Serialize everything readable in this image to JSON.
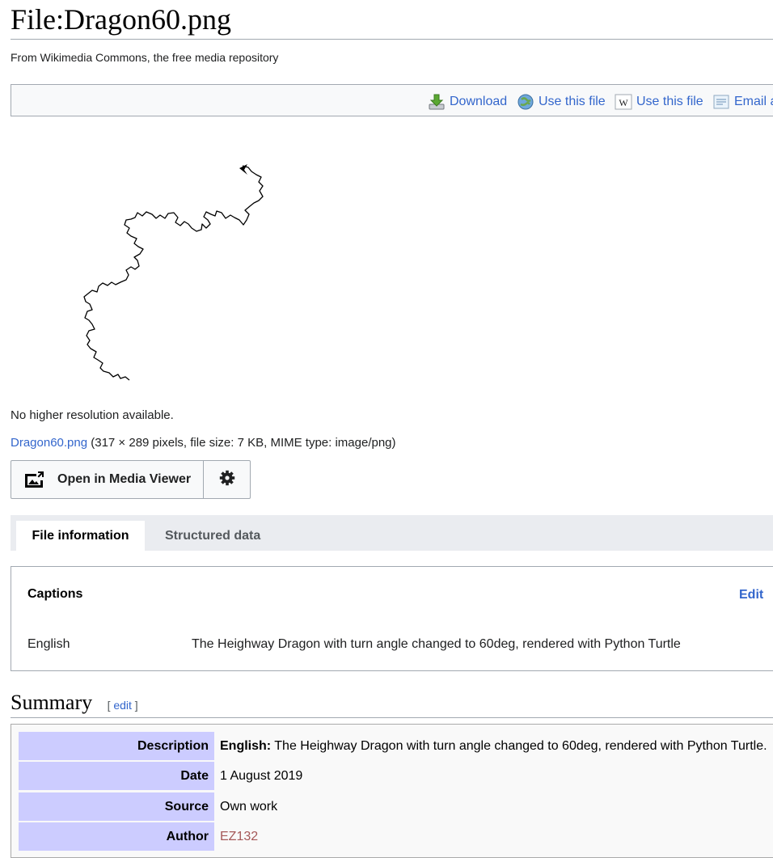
{
  "page": {
    "title": "File:Dragon60.png",
    "subtitle": "From Wikimedia Commons, the free media repository"
  },
  "toolbar": {
    "download": "Download",
    "use_web": "Use this file",
    "use_wiki": "Use this file",
    "email": "Email a"
  },
  "file": {
    "no_hires": "No higher resolution available.",
    "name_link": "Dragon60.png",
    "details": " (317 × 289 pixels, file size: 7 KB, MIME type: image/png)"
  },
  "media_viewer": {
    "open_label": "Open in Media Viewer"
  },
  "tabs": [
    {
      "label": "File information"
    },
    {
      "label": "Structured data"
    }
  ],
  "captions": {
    "title": "Captions",
    "edit": "Edit",
    "language": "English",
    "text": "The Heighway Dragon with turn angle changed to 60deg, rendered with Python Turtle"
  },
  "summary": {
    "heading": "Summary",
    "edit_open": "[ ",
    "edit_label": "edit",
    "edit_close": " ]",
    "rows": [
      {
        "key": "Description",
        "lang": "English:",
        "value": " The Heighway Dragon with turn angle changed to 60deg, rendered with Python Turtle."
      },
      {
        "key": "Date",
        "value": "1 August 2019"
      },
      {
        "key": "Source",
        "value": "Own work"
      },
      {
        "key": "Author",
        "value": "EZ132"
      }
    ]
  },
  "colors": {
    "link": "#3366cc",
    "author_link": "#a55858",
    "infobox_key_bg": "#ccccff"
  }
}
